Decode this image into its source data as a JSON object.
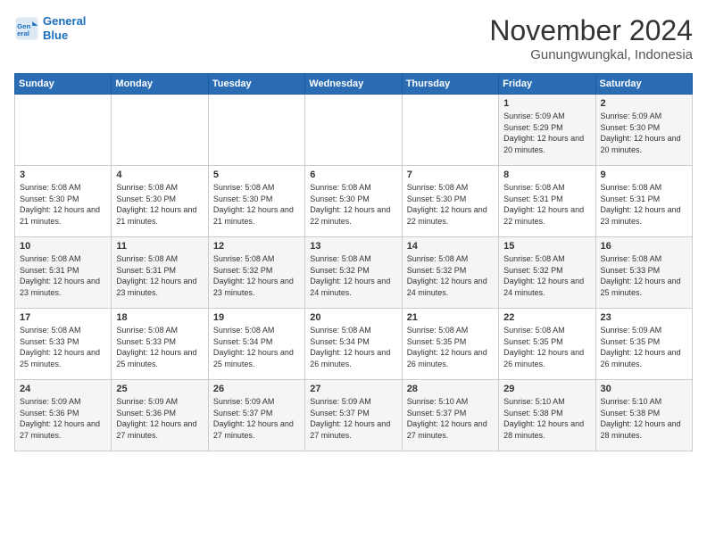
{
  "header": {
    "logo_line1": "General",
    "logo_line2": "Blue",
    "month": "November 2024",
    "location": "Gunungwungkal, Indonesia"
  },
  "weekdays": [
    "Sunday",
    "Monday",
    "Tuesday",
    "Wednesday",
    "Thursday",
    "Friday",
    "Saturday"
  ],
  "weeks": [
    [
      {
        "day": "",
        "sunrise": "",
        "sunset": "",
        "daylight": ""
      },
      {
        "day": "",
        "sunrise": "",
        "sunset": "",
        "daylight": ""
      },
      {
        "day": "",
        "sunrise": "",
        "sunset": "",
        "daylight": ""
      },
      {
        "day": "",
        "sunrise": "",
        "sunset": "",
        "daylight": ""
      },
      {
        "day": "",
        "sunrise": "",
        "sunset": "",
        "daylight": ""
      },
      {
        "day": "1",
        "sunrise": "Sunrise: 5:09 AM",
        "sunset": "Sunset: 5:29 PM",
        "daylight": "Daylight: 12 hours and 20 minutes."
      },
      {
        "day": "2",
        "sunrise": "Sunrise: 5:09 AM",
        "sunset": "Sunset: 5:30 PM",
        "daylight": "Daylight: 12 hours and 20 minutes."
      }
    ],
    [
      {
        "day": "3",
        "sunrise": "Sunrise: 5:08 AM",
        "sunset": "Sunset: 5:30 PM",
        "daylight": "Daylight: 12 hours and 21 minutes."
      },
      {
        "day": "4",
        "sunrise": "Sunrise: 5:08 AM",
        "sunset": "Sunset: 5:30 PM",
        "daylight": "Daylight: 12 hours and 21 minutes."
      },
      {
        "day": "5",
        "sunrise": "Sunrise: 5:08 AM",
        "sunset": "Sunset: 5:30 PM",
        "daylight": "Daylight: 12 hours and 21 minutes."
      },
      {
        "day": "6",
        "sunrise": "Sunrise: 5:08 AM",
        "sunset": "Sunset: 5:30 PM",
        "daylight": "Daylight: 12 hours and 22 minutes."
      },
      {
        "day": "7",
        "sunrise": "Sunrise: 5:08 AM",
        "sunset": "Sunset: 5:30 PM",
        "daylight": "Daylight: 12 hours and 22 minutes."
      },
      {
        "day": "8",
        "sunrise": "Sunrise: 5:08 AM",
        "sunset": "Sunset: 5:31 PM",
        "daylight": "Daylight: 12 hours and 22 minutes."
      },
      {
        "day": "9",
        "sunrise": "Sunrise: 5:08 AM",
        "sunset": "Sunset: 5:31 PM",
        "daylight": "Daylight: 12 hours and 23 minutes."
      }
    ],
    [
      {
        "day": "10",
        "sunrise": "Sunrise: 5:08 AM",
        "sunset": "Sunset: 5:31 PM",
        "daylight": "Daylight: 12 hours and 23 minutes."
      },
      {
        "day": "11",
        "sunrise": "Sunrise: 5:08 AM",
        "sunset": "Sunset: 5:31 PM",
        "daylight": "Daylight: 12 hours and 23 minutes."
      },
      {
        "day": "12",
        "sunrise": "Sunrise: 5:08 AM",
        "sunset": "Sunset: 5:32 PM",
        "daylight": "Daylight: 12 hours and 23 minutes."
      },
      {
        "day": "13",
        "sunrise": "Sunrise: 5:08 AM",
        "sunset": "Sunset: 5:32 PM",
        "daylight": "Daylight: 12 hours and 24 minutes."
      },
      {
        "day": "14",
        "sunrise": "Sunrise: 5:08 AM",
        "sunset": "Sunset: 5:32 PM",
        "daylight": "Daylight: 12 hours and 24 minutes."
      },
      {
        "day": "15",
        "sunrise": "Sunrise: 5:08 AM",
        "sunset": "Sunset: 5:32 PM",
        "daylight": "Daylight: 12 hours and 24 minutes."
      },
      {
        "day": "16",
        "sunrise": "Sunrise: 5:08 AM",
        "sunset": "Sunset: 5:33 PM",
        "daylight": "Daylight: 12 hours and 25 minutes."
      }
    ],
    [
      {
        "day": "17",
        "sunrise": "Sunrise: 5:08 AM",
        "sunset": "Sunset: 5:33 PM",
        "daylight": "Daylight: 12 hours and 25 minutes."
      },
      {
        "day": "18",
        "sunrise": "Sunrise: 5:08 AM",
        "sunset": "Sunset: 5:33 PM",
        "daylight": "Daylight: 12 hours and 25 minutes."
      },
      {
        "day": "19",
        "sunrise": "Sunrise: 5:08 AM",
        "sunset": "Sunset: 5:34 PM",
        "daylight": "Daylight: 12 hours and 25 minutes."
      },
      {
        "day": "20",
        "sunrise": "Sunrise: 5:08 AM",
        "sunset": "Sunset: 5:34 PM",
        "daylight": "Daylight: 12 hours and 26 minutes."
      },
      {
        "day": "21",
        "sunrise": "Sunrise: 5:08 AM",
        "sunset": "Sunset: 5:35 PM",
        "daylight": "Daylight: 12 hours and 26 minutes."
      },
      {
        "day": "22",
        "sunrise": "Sunrise: 5:08 AM",
        "sunset": "Sunset: 5:35 PM",
        "daylight": "Daylight: 12 hours and 26 minutes."
      },
      {
        "day": "23",
        "sunrise": "Sunrise: 5:09 AM",
        "sunset": "Sunset: 5:35 PM",
        "daylight": "Daylight: 12 hours and 26 minutes."
      }
    ],
    [
      {
        "day": "24",
        "sunrise": "Sunrise: 5:09 AM",
        "sunset": "Sunset: 5:36 PM",
        "daylight": "Daylight: 12 hours and 27 minutes."
      },
      {
        "day": "25",
        "sunrise": "Sunrise: 5:09 AM",
        "sunset": "Sunset: 5:36 PM",
        "daylight": "Daylight: 12 hours and 27 minutes."
      },
      {
        "day": "26",
        "sunrise": "Sunrise: 5:09 AM",
        "sunset": "Sunset: 5:37 PM",
        "daylight": "Daylight: 12 hours and 27 minutes."
      },
      {
        "day": "27",
        "sunrise": "Sunrise: 5:09 AM",
        "sunset": "Sunset: 5:37 PM",
        "daylight": "Daylight: 12 hours and 27 minutes."
      },
      {
        "day": "28",
        "sunrise": "Sunrise: 5:10 AM",
        "sunset": "Sunset: 5:37 PM",
        "daylight": "Daylight: 12 hours and 27 minutes."
      },
      {
        "day": "29",
        "sunrise": "Sunrise: 5:10 AM",
        "sunset": "Sunset: 5:38 PM",
        "daylight": "Daylight: 12 hours and 28 minutes."
      },
      {
        "day": "30",
        "sunrise": "Sunrise: 5:10 AM",
        "sunset": "Sunset: 5:38 PM",
        "daylight": "Daylight: 12 hours and 28 minutes."
      }
    ]
  ]
}
